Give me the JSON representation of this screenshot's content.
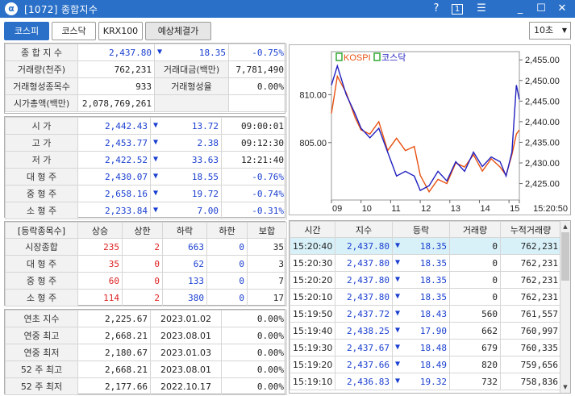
{
  "window": {
    "logo": "α",
    "title": "[1072] 종합지수",
    "help": "?",
    "num": "1",
    "menu_icon": "☰",
    "min": "_",
    "max": "☐",
    "close": "✕"
  },
  "tabs": [
    {
      "label": "코스피"
    },
    {
      "label": "코스닥"
    },
    {
      "label": "KRX100"
    },
    {
      "label": "예상체결가"
    }
  ],
  "interval": "10초",
  "summary": {
    "rows": [
      {
        "l1": "종 합 지 수",
        "v1": "2,437.80",
        "arrow": "▼",
        "chg": "18.35",
        "pct": "-0.75%"
      },
      {
        "l1": "거래량(천주)",
        "v1": "762,231",
        "l2": "거래대금(백만)",
        "v2": "7,781,490"
      },
      {
        "l1": "거래형성종목수",
        "v1": "933",
        "l2": "거래형성율",
        "v2": "0.00%"
      },
      {
        "l1": "시가총액(백만)",
        "v1": "2,078,769,261"
      }
    ]
  },
  "ohlc": [
    {
      "label": "시 가",
      "value": "2,442.43",
      "arrow": "▼",
      "chg": "13.72",
      "extra": "09:00:01"
    },
    {
      "label": "고 가",
      "value": "2,453.77",
      "arrow": "▼",
      "chg": "2.38",
      "extra": "09:12:30"
    },
    {
      "label": "저 가",
      "value": "2,422.52",
      "arrow": "▼",
      "chg": "33.63",
      "extra": "12:21:40"
    },
    {
      "label": "대 형 주",
      "value": "2,430.07",
      "arrow": "▼",
      "chg": "18.55",
      "extra": "-0.76%"
    },
    {
      "label": "중 형 주",
      "value": "2,658.16",
      "arrow": "▼",
      "chg": "19.72",
      "extra": "-0.74%"
    },
    {
      "label": "소 형 주",
      "value": "2,233.84",
      "arrow": "▼",
      "chg": "7.00",
      "extra": "-0.31%"
    }
  ],
  "breadth": {
    "headers": [
      "[등락종목수]",
      "상승",
      "상한",
      "하락",
      "하한",
      "보합"
    ],
    "rows": [
      {
        "label": "시장종합",
        "up": "235",
        "uplim": "2",
        "down": "663",
        "downlim": "0",
        "flat": "35"
      },
      {
        "label": "대 형 주",
        "up": "35",
        "uplim": "0",
        "down": "62",
        "downlim": "0",
        "flat": "3"
      },
      {
        "label": "중 형 주",
        "up": "60",
        "uplim": "0",
        "down": "133",
        "downlim": "0",
        "flat": "7"
      },
      {
        "label": "소 형 주",
        "up": "114",
        "uplim": "2",
        "down": "380",
        "downlim": "0",
        "flat": "17"
      }
    ]
  },
  "yearly": [
    {
      "label": "연초 지수",
      "value": "2,225.67",
      "date": "2023.01.02",
      "pct": "0.00%"
    },
    {
      "label": "연중 최고",
      "value": "2,668.21",
      "date": "2023.08.01",
      "pct": "0.00%"
    },
    {
      "label": "연중 최저",
      "value": "2,180.67",
      "date": "2023.01.03",
      "pct": "0.00%"
    },
    {
      "label": "52 주 최고",
      "value": "2,668.21",
      "date": "2023.08.01",
      "pct": "0.00%"
    },
    {
      "label": "52 주 최저",
      "value": "2,177.66",
      "date": "2022.10.17",
      "pct": "0.00%"
    }
  ],
  "ticks": {
    "headers": [
      "시간",
      "지수",
      "등락",
      "거래량",
      "누적거래량"
    ],
    "rows": [
      {
        "time": "15:20:40",
        "index": "2,437.80",
        "arrow": "▼",
        "chg": "18.35",
        "vol": "0",
        "cum": "762,231"
      },
      {
        "time": "15:20:30",
        "index": "2,437.80",
        "arrow": "▼",
        "chg": "18.35",
        "vol": "0",
        "cum": "762,231"
      },
      {
        "time": "15:20:20",
        "index": "2,437.80",
        "arrow": "▼",
        "chg": "18.35",
        "vol": "0",
        "cum": "762,231"
      },
      {
        "time": "15:20:10",
        "index": "2,437.80",
        "arrow": "▼",
        "chg": "18.35",
        "vol": "0",
        "cum": "762,231"
      },
      {
        "time": "15:19:50",
        "index": "2,437.72",
        "arrow": "▼",
        "chg": "18.43",
        "vol": "560",
        "cum": "761,557"
      },
      {
        "time": "15:19:40",
        "index": "2,438.25",
        "arrow": "▼",
        "chg": "17.90",
        "vol": "662",
        "cum": "760,997"
      },
      {
        "time": "15:19:30",
        "index": "2,437.67",
        "arrow": "▼",
        "chg": "18.48",
        "vol": "679",
        "cum": "760,335"
      },
      {
        "time": "15:19:20",
        "index": "2,437.66",
        "arrow": "▼",
        "chg": "18.49",
        "vol": "820",
        "cum": "759,656"
      },
      {
        "time": "15:19:10",
        "index": "2,436.83",
        "arrow": "▼",
        "chg": "19.32",
        "vol": "732",
        "cum": "758,836"
      }
    ]
  },
  "chart_data": {
    "type": "line",
    "legend": [
      "KOSPI",
      "코스닥"
    ],
    "colors": {
      "KOSPI": "#e85010",
      "코스닥": "#2020c0"
    },
    "left_ticks": [
      "810.00",
      "805.00"
    ],
    "left_tick_values": [
      810,
      805
    ],
    "right_ticks": [
      "2,455.00",
      "2,450.00",
      "2,445.00",
      "2,440.00",
      "2,435.00",
      "2,430.00",
      "2,425.00"
    ],
    "right_tick_values": [
      2455,
      2450,
      2445,
      2440,
      2435,
      2430,
      2425
    ],
    "x_ticks": [
      "09",
      "10",
      "11",
      "12",
      "13",
      "14",
      "15",
      "15:20:50"
    ],
    "x_tick_values": [
      9,
      10,
      11,
      12,
      13,
      14,
      15,
      15.35
    ],
    "x_range": [
      9,
      15.35
    ],
    "right_range": [
      2421,
      2457
    ],
    "left_range": [
      799,
      814.5
    ],
    "series": [
      {
        "name": "KOSPI",
        "axis": "right",
        "x": [
          9.0,
          9.2,
          9.5,
          9.8,
          10.0,
          10.3,
          10.6,
          10.9,
          11.2,
          11.5,
          11.8,
          12.0,
          12.3,
          12.6,
          12.9,
          13.2,
          13.5,
          13.8,
          14.1,
          14.4,
          14.7,
          14.9,
          15.1,
          15.25,
          15.35
        ],
        "y": [
          2442,
          2451,
          2447,
          2441,
          2438,
          2437,
          2440,
          2433,
          2436,
          2433,
          2434,
          2427,
          2423,
          2426,
          2425,
          2430,
          2429,
          2432,
          2428,
          2431,
          2429,
          2427,
          2432,
          2437,
          2438
        ]
      },
      {
        "name": "코스닥",
        "axis": "left",
        "x": [
          9.0,
          9.2,
          9.5,
          9.8,
          10.0,
          10.3,
          10.6,
          10.9,
          11.2,
          11.5,
          11.8,
          12.0,
          12.3,
          12.6,
          12.9,
          13.2,
          13.5,
          13.8,
          14.1,
          14.4,
          14.7,
          14.9,
          15.1,
          15.25,
          15.35
        ],
        "y": [
          811,
          813,
          810,
          808,
          806.5,
          805.5,
          806.5,
          804,
          801.5,
          802,
          801.5,
          800,
          800.5,
          802,
          801,
          803,
          802,
          804,
          802.5,
          803.5,
          803,
          801.5,
          804,
          811,
          809.5
        ]
      }
    ]
  }
}
